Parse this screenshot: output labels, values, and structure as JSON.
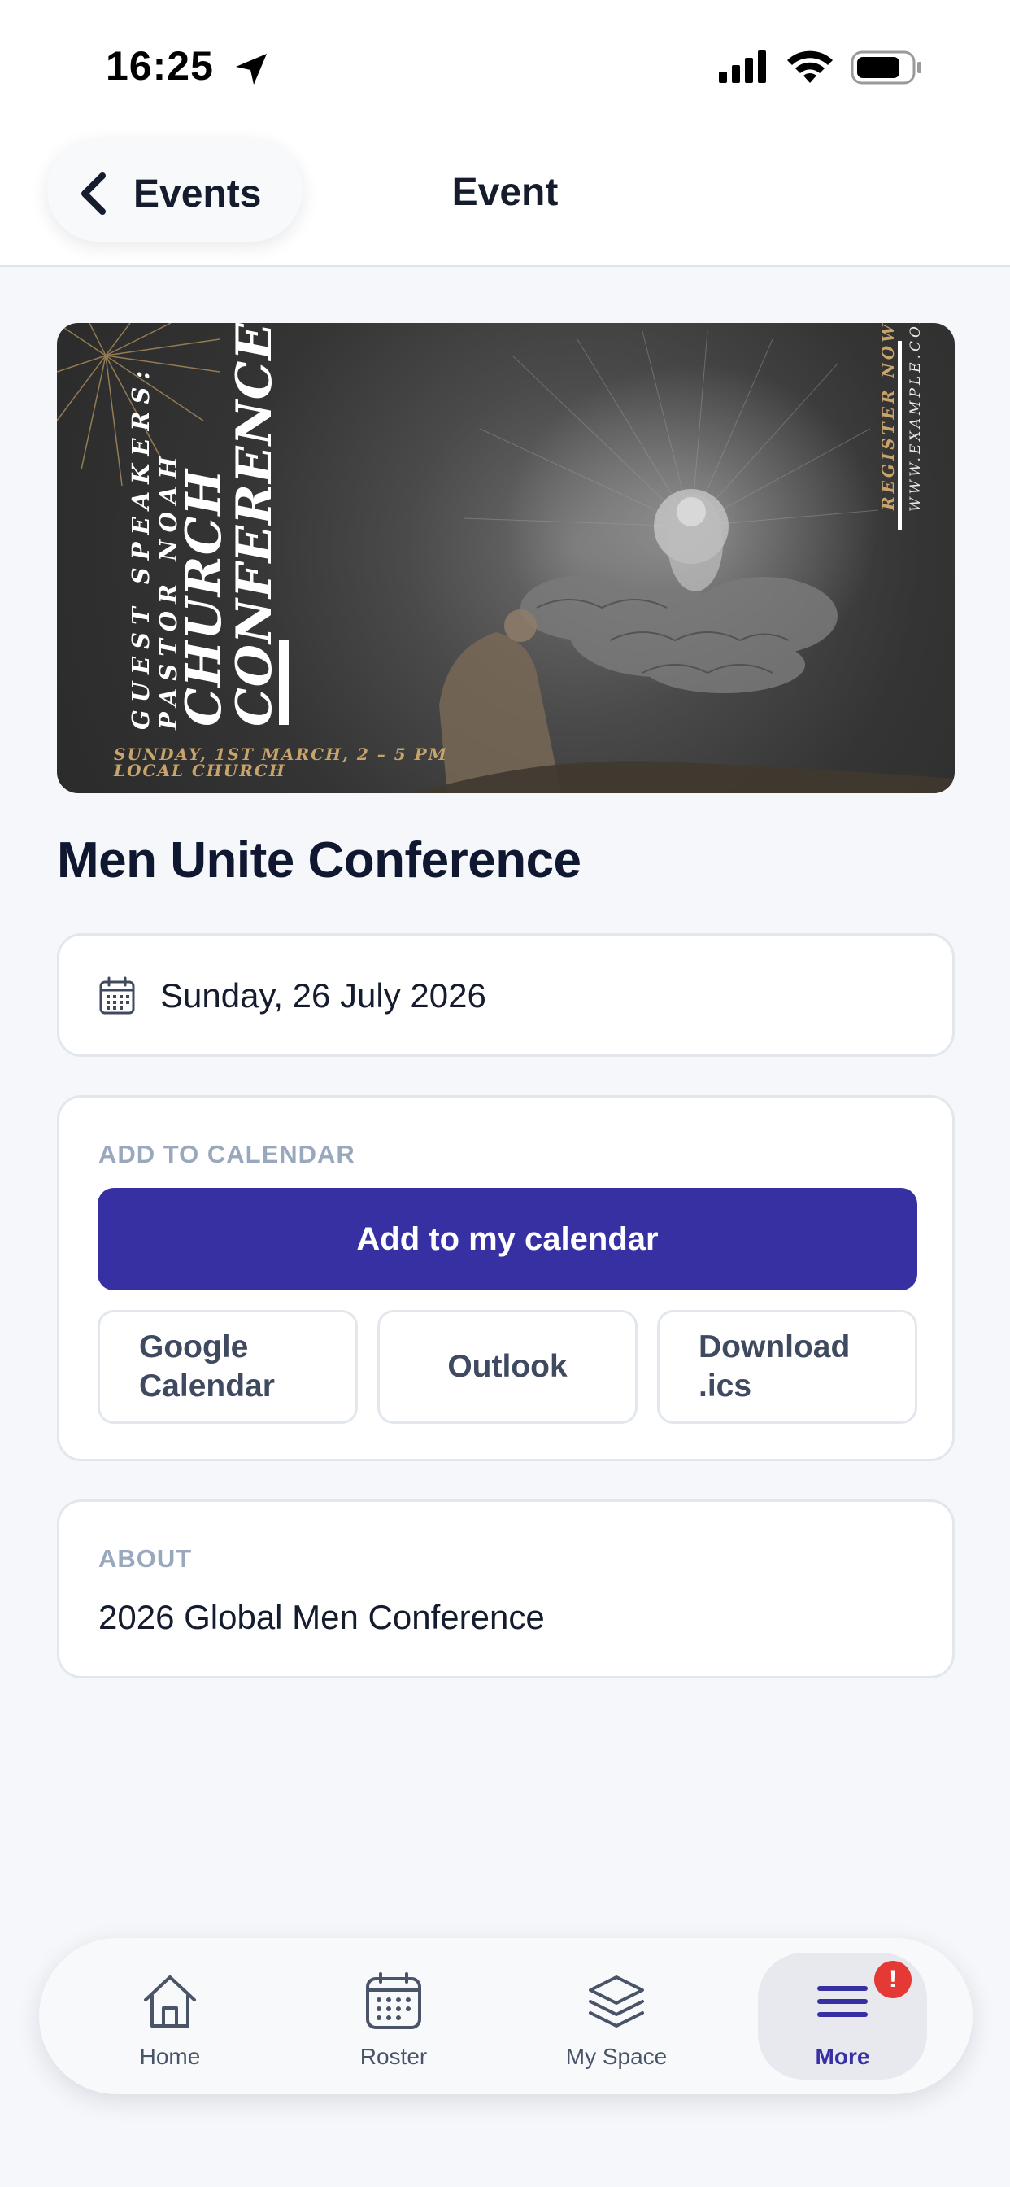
{
  "status_bar": {
    "time": "16:25"
  },
  "nav": {
    "back_label": "Events",
    "title": "Event"
  },
  "banner": {
    "speakers_line1": "GUEST SPEAKERS:",
    "speakers_line2": "PASTOR NOAH",
    "title_line1": "CHURCH",
    "title_line2": "CONFERENCE",
    "date_line1": "SUNDAY, 1ST MARCH, 2 – 5 PM",
    "date_line2": "LOCAL CHURCH",
    "register": "REGISTER NOW",
    "website": "WWW.EXAMPLE.COM"
  },
  "event": {
    "title": "Men Unite Conference",
    "date": "Sunday, 26 July 2026"
  },
  "calendar": {
    "section_label": "ADD TO CALENDAR",
    "primary_label": "Add to my calendar",
    "google_label": "Google\nCalendar",
    "outlook_label": "Outlook",
    "ics_label": "Download\n.ics"
  },
  "about": {
    "section_label": "ABOUT",
    "text": "2026 Global Men Conference"
  },
  "tabbar": {
    "items": [
      {
        "label": "Home",
        "icon": "home-icon"
      },
      {
        "label": "Roster",
        "icon": "calendar-grid-icon"
      },
      {
        "label": "My Space",
        "icon": "layers-icon"
      },
      {
        "label": "More",
        "icon": "menu-icon",
        "active": true,
        "badge": "!"
      }
    ]
  },
  "colors": {
    "primary": "#3730a3",
    "badge": "#e53935",
    "banner_gold": "#c9a46a"
  }
}
